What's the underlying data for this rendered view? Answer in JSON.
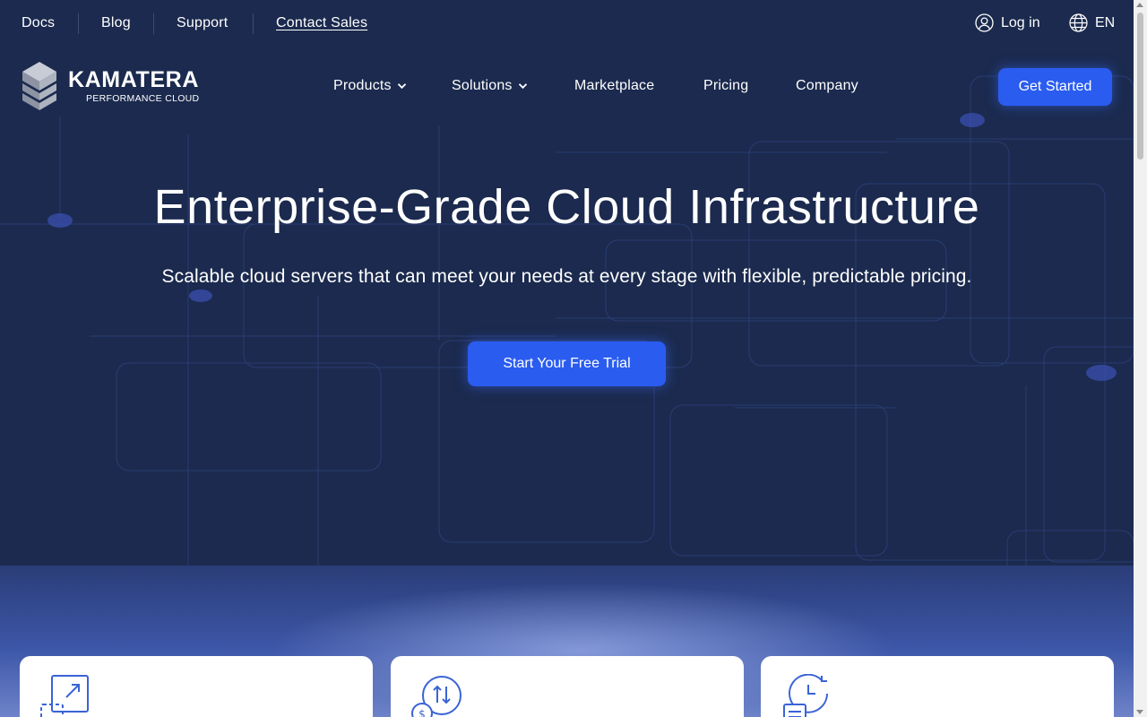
{
  "utility_nav": {
    "docs": "Docs",
    "blog": "Blog",
    "support": "Support",
    "contact_sales": "Contact Sales",
    "login": "Log in",
    "language": "EN"
  },
  "brand": {
    "name": "KAMATERA",
    "tagline": "PERFORMANCE CLOUD"
  },
  "main_nav": {
    "items": [
      {
        "label": "Products",
        "has_dropdown": true
      },
      {
        "label": "Solutions",
        "has_dropdown": true
      },
      {
        "label": "Marketplace",
        "has_dropdown": false
      },
      {
        "label": "Pricing",
        "has_dropdown": false
      },
      {
        "label": "Company",
        "has_dropdown": false
      }
    ],
    "cta": "Get Started"
  },
  "hero": {
    "title": "Enterprise-Grade Cloud Infrastructure",
    "subtitle": "Scalable cloud servers that can meet your needs at every stage with flexible, predictable pricing.",
    "cta": "Start Your Free Trial"
  },
  "feature_cards": [
    {
      "icon": "scale-resize-icon"
    },
    {
      "icon": "cost-exchange-icon"
    },
    {
      "icon": "clock-document-icon"
    }
  ],
  "colors": {
    "background": "#1b2a4e",
    "accent": "#2a5cf0",
    "card_background": "#ffffff",
    "icon_stroke": "#3a63d6"
  }
}
